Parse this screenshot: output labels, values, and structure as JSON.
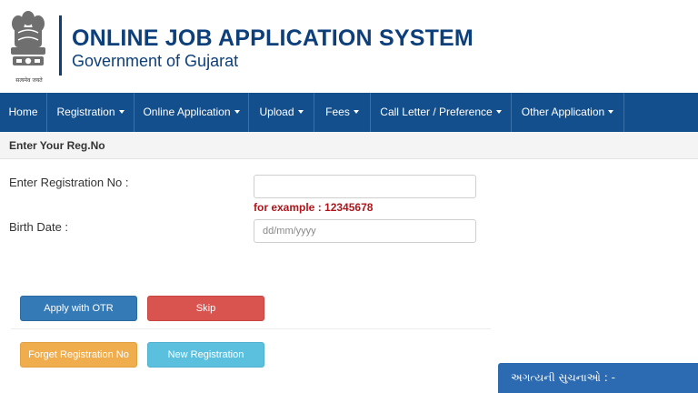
{
  "header": {
    "title": "ONLINE JOB APPLICATION SYSTEM",
    "subtitle": "Government of Gujarat",
    "emblem_motto": "सत्यमेव जयते",
    "brand_color": "#0d3f7a"
  },
  "nav": {
    "background": "#134f8c",
    "items": [
      {
        "label": "Home",
        "has_dropdown": false
      },
      {
        "label": "Registration",
        "has_dropdown": true
      },
      {
        "label": "Online Application",
        "has_dropdown": true
      },
      {
        "label": "Upload",
        "has_dropdown": true
      },
      {
        "label": "Fees",
        "has_dropdown": true
      },
      {
        "label": "Call Letter / Preference",
        "has_dropdown": true
      },
      {
        "label": "Other Application",
        "has_dropdown": true
      }
    ]
  },
  "section": {
    "title": "Enter Your Reg.No"
  },
  "form": {
    "reg_label": "Enter Registration No :",
    "reg_value": "",
    "reg_example": "for example : 12345678",
    "birth_label": "Birth Date :",
    "birth_placeholder": "dd/mm/yyyy",
    "birth_value": ""
  },
  "buttons": {
    "apply_otr": "Apply with OTR",
    "skip": "Skip",
    "forget_reg": "Forget Registration No",
    "new_reg": "New Registration"
  },
  "notice": {
    "label": "અગત્યની સુચનાઓ : -"
  }
}
